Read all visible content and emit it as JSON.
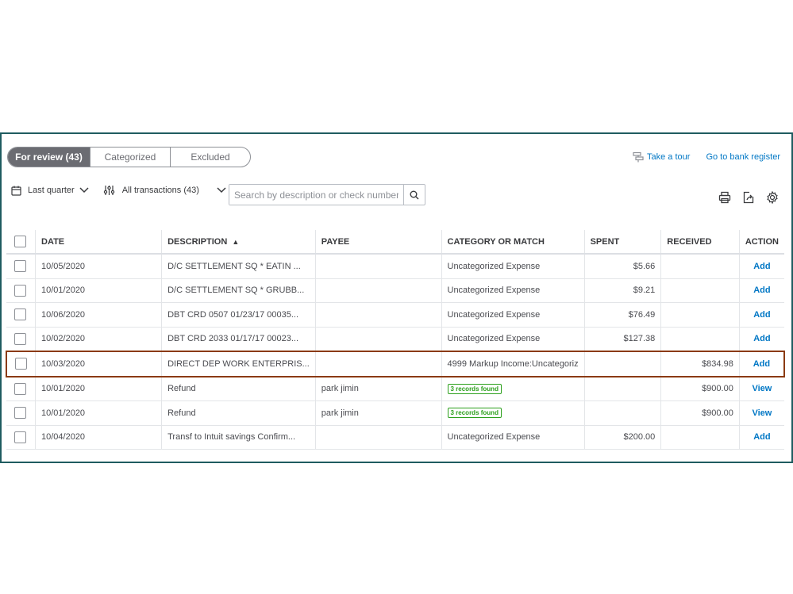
{
  "tabs": [
    "For review (43)",
    "Categorized",
    "Excluded"
  ],
  "links": {
    "tour": "Take a tour",
    "register": "Go to bank register"
  },
  "filters": {
    "date": "Last quarter",
    "transactions": "All transactions (43)"
  },
  "search": {
    "placeholder": "Search by description or check number",
    "value": ""
  },
  "columns": [
    "DATE",
    "DESCRIPTION",
    "PAYEE",
    "CATEGORY OR MATCH",
    "SPENT",
    "RECEIVED",
    "ACTION"
  ],
  "sort_indicator": "▲",
  "rows": [
    {
      "date": "10/05/2020",
      "description": "D/C SETTLEMENT  SQ * EATIN ...",
      "payee": "",
      "category": "Uncategorized Expense",
      "spent": "$5.66",
      "received": "",
      "action": "Add"
    },
    {
      "date": "10/01/2020",
      "description": "D/C SETTLEMENT  SQ * GRUBB...",
      "payee": "",
      "category": "Uncategorized Expense",
      "spent": "$9.21",
      "received": "",
      "action": "Add"
    },
    {
      "date": "10/06/2020",
      "description": "DBT CRD 0507 01/23/17 00035...",
      "payee": "",
      "category": "Uncategorized Expense",
      "spent": "$76.49",
      "received": "",
      "action": "Add"
    },
    {
      "date": "10/02/2020",
      "description": "DBT CRD 2033 01/17/17 00023...",
      "payee": "",
      "category": "Uncategorized Expense",
      "spent": "$127.38",
      "received": "",
      "action": "Add"
    },
    {
      "date": "10/03/2020",
      "description": "DIRECT DEP WORK ENTERPRIS...",
      "payee": "",
      "category": "4999 Markup Income:Uncategoriz",
      "spent": "",
      "received": "$834.98",
      "action": "Add",
      "highlighted": true
    },
    {
      "date": "10/01/2020",
      "description": "Refund",
      "payee": "park jimin",
      "category": "3 records found",
      "badge": true,
      "spent": "",
      "received": "$900.00",
      "action": "View"
    },
    {
      "date": "10/01/2020",
      "description": "Refund",
      "payee": "park jimin",
      "category": "3 records found",
      "badge": true,
      "spent": "",
      "received": "$900.00",
      "action": "View"
    },
    {
      "date": "10/04/2020",
      "description": "Transf to Intuit savings Confirm...",
      "payee": "",
      "category": "Uncategorized Expense",
      "spent": "$200.00",
      "received": "",
      "action": "Add"
    }
  ],
  "colors": {
    "frame": "#1f5c60",
    "highlight": "#8b3a0e",
    "link": "#0077c5",
    "badge": "#2ca01c"
  }
}
